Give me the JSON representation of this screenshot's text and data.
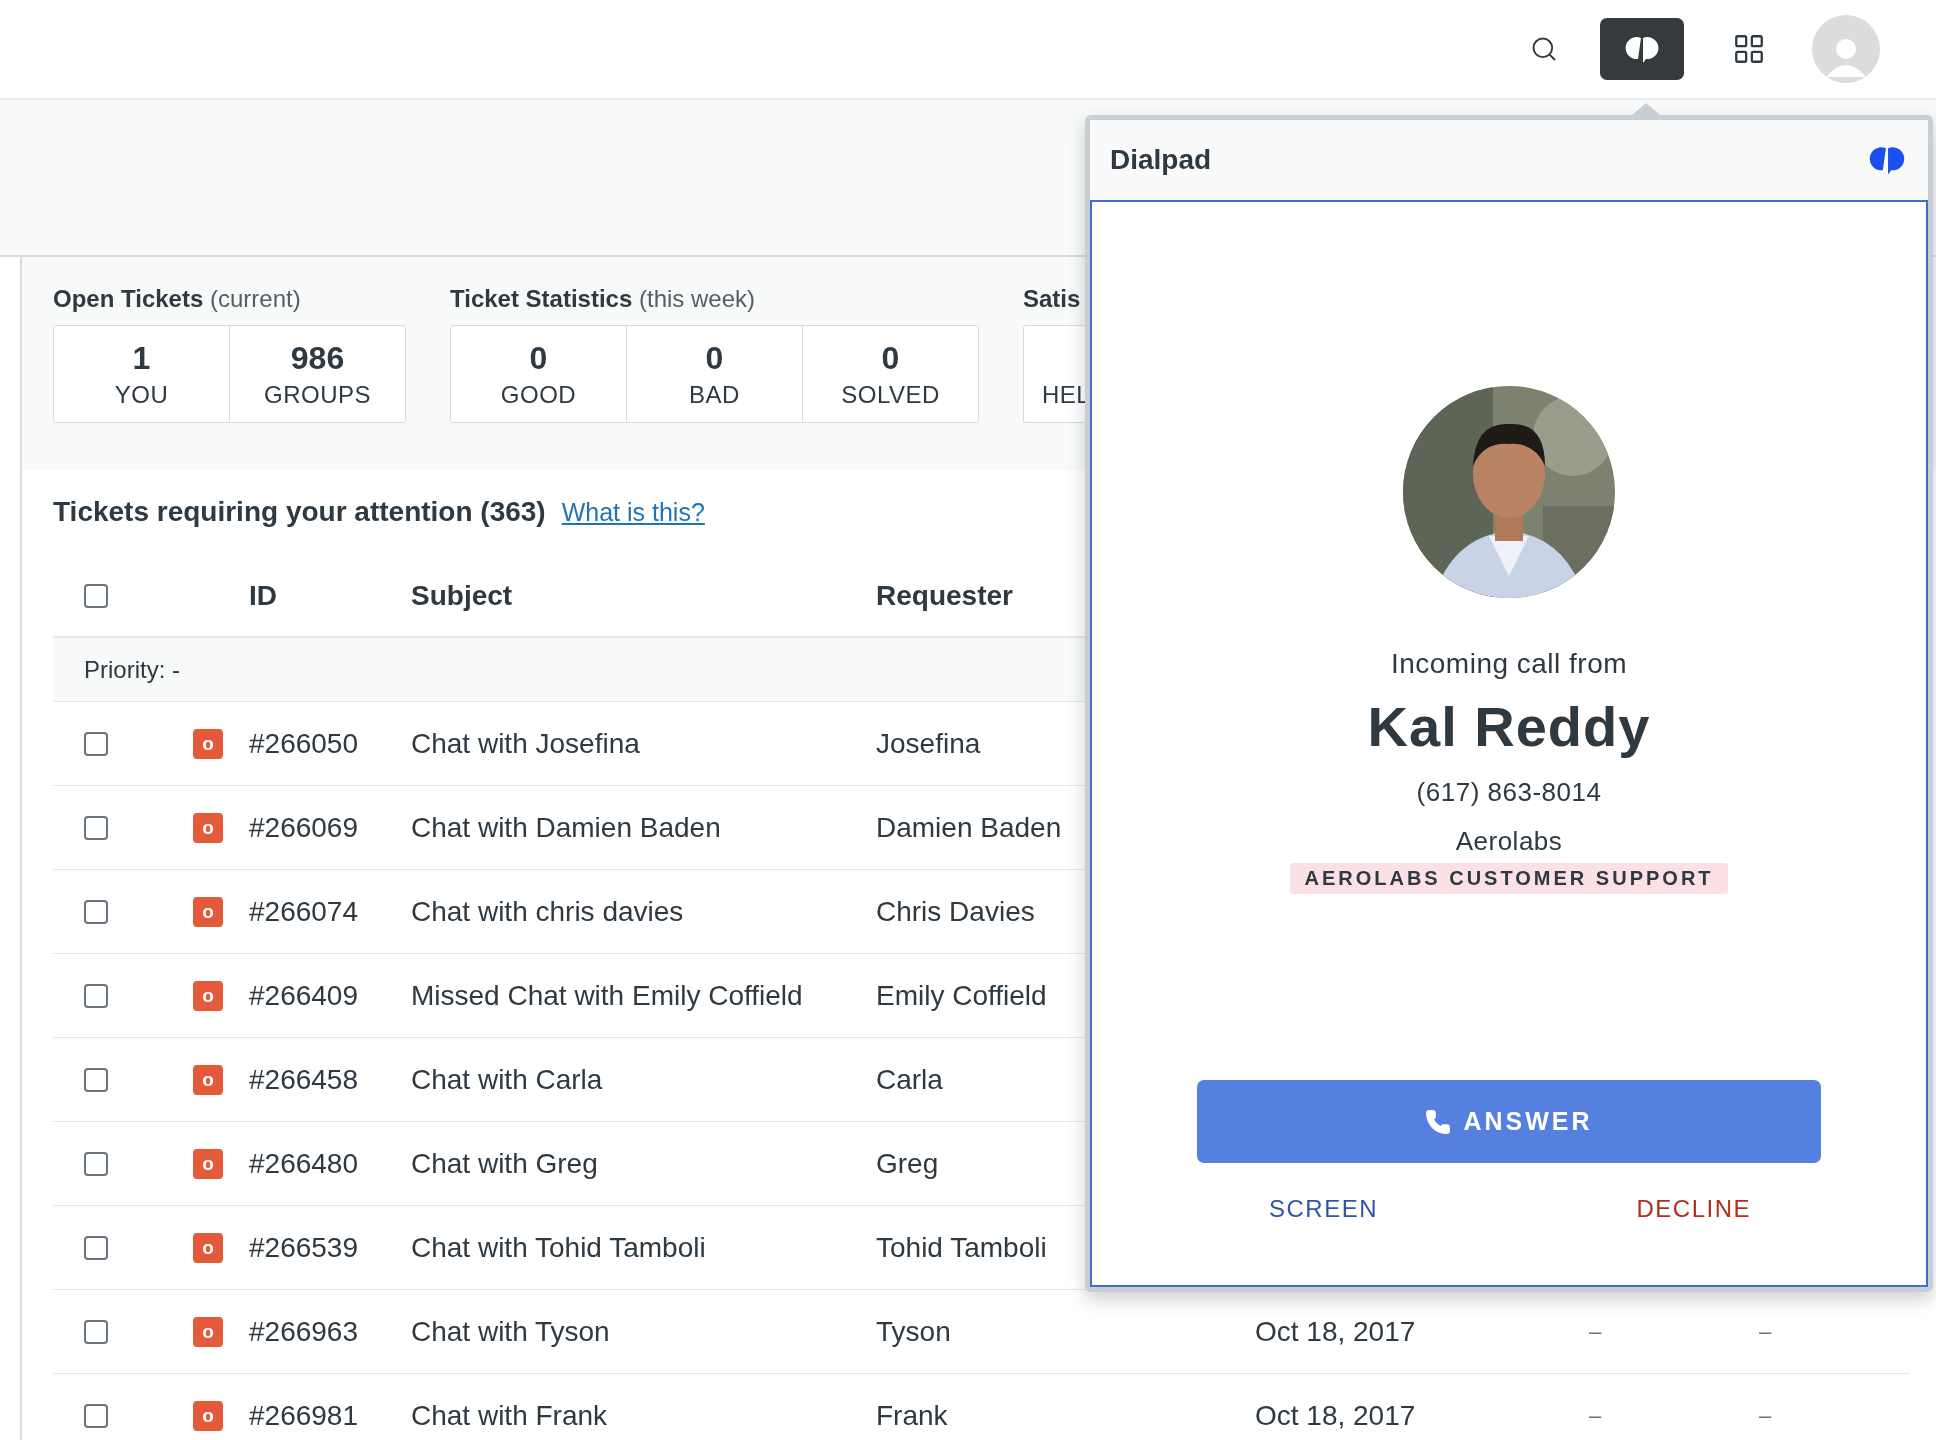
{
  "stat_groups": [
    {
      "title": "Open Tickets",
      "subtitle": "(current)",
      "cells": [
        {
          "value": "1",
          "label": "YOU"
        },
        {
          "value": "986",
          "label": "GROUPS"
        }
      ]
    },
    {
      "title": "Ticket Statistics",
      "subtitle": "(this week)",
      "cells": [
        {
          "value": "0",
          "label": "GOOD"
        },
        {
          "value": "0",
          "label": "BAD"
        },
        {
          "value": "0",
          "label": "SOLVED"
        }
      ]
    },
    {
      "title": "Satis",
      "cells": [
        {
          "label": "HEL"
        }
      ]
    }
  ],
  "tickets": {
    "title": "Tickets requiring your attention (363)",
    "help_link": "What is this?",
    "header": {
      "checked": false,
      "columns": [
        "ID",
        "Subject",
        "Requester"
      ]
    },
    "group_label": "Priority: -",
    "rows": [
      {
        "checked": false,
        "status": "o",
        "id": "#266050",
        "subject": "Chat with Josefina",
        "requester": "Josefina"
      },
      {
        "checked": false,
        "status": "o",
        "id": "#266069",
        "subject": "Chat with Damien Baden",
        "requester": "Damien Baden"
      },
      {
        "checked": false,
        "status": "o",
        "id": "#266074",
        "subject": "Chat with chris davies",
        "requester": "Chris Davies"
      },
      {
        "checked": false,
        "status": "o",
        "id": "#266409",
        "subject": "Missed Chat with Emily Coffield",
        "requester": "Emily Coffield"
      },
      {
        "checked": false,
        "status": "o",
        "id": "#266458",
        "subject": "Chat with Carla",
        "requester": "Carla"
      },
      {
        "checked": false,
        "status": "o",
        "id": "#266480",
        "subject": "Chat with Greg",
        "requester": "Greg"
      },
      {
        "checked": false,
        "status": "o",
        "id": "#266539",
        "subject": "Chat with Tohid Tamboli",
        "requester": "Tohid Tamboli"
      },
      {
        "checked": false,
        "status": "o",
        "id": "#266963",
        "subject": "Chat with Tyson",
        "requester": "Tyson",
        "date": "Oct 18, 2017",
        "column_5": "–",
        "column_6": "–"
      },
      {
        "checked": false,
        "status": "o",
        "id": "#266981",
        "subject": "Chat with Frank",
        "requester": "Frank",
        "date": "Oct 18, 2017",
        "column_5": "–",
        "column_6": "–"
      }
    ]
  },
  "dialpad": {
    "title": "Dialpad",
    "call": {
      "caption": "Incoming call from",
      "name": "Kal Reddy",
      "phone": "(617) 863-8014",
      "company": "Aerolabs",
      "tag": "AEROLABS CUSTOMER SUPPORT",
      "answer": "ANSWER",
      "screen": "SCREEN",
      "decline": "DECLINE"
    }
  }
}
